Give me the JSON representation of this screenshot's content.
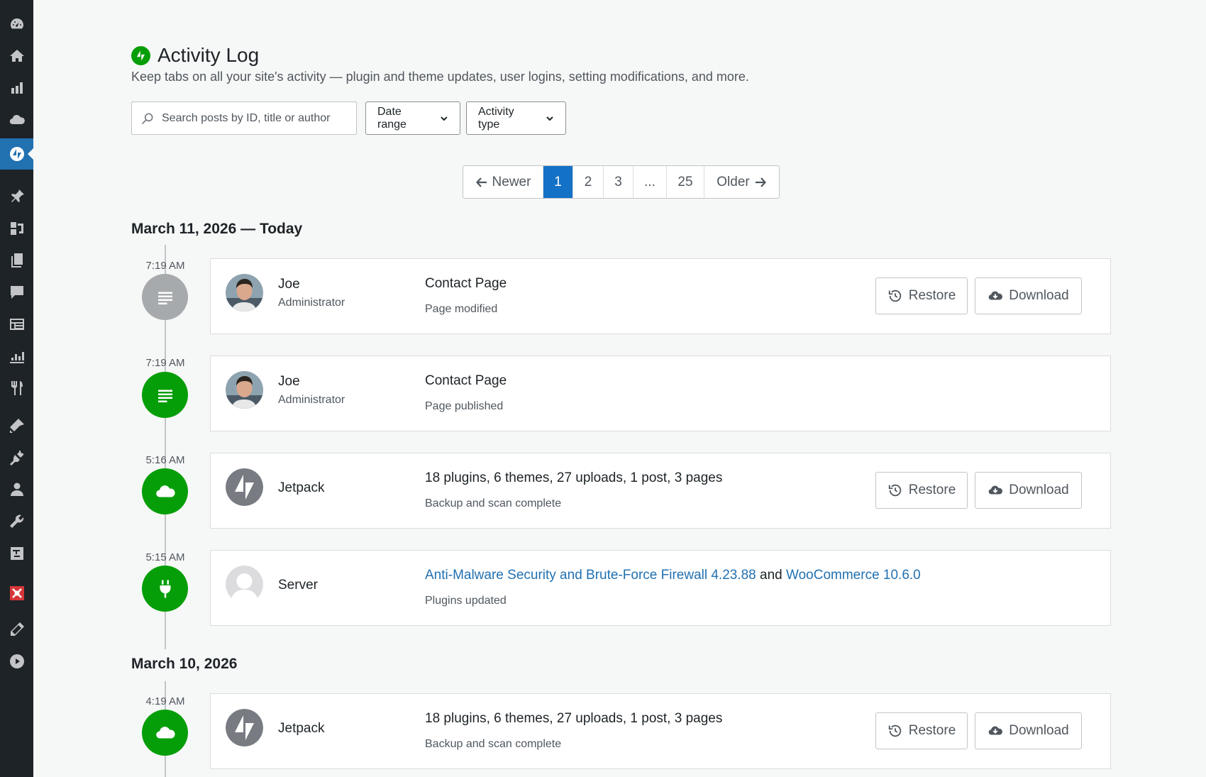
{
  "sidebar": {
    "items": [
      {
        "icon": "dashboard-icon"
      },
      {
        "icon": "home-icon"
      },
      {
        "icon": "stats-icon"
      },
      {
        "icon": "cloud-icon"
      },
      {
        "icon": "jetpack-icon",
        "active": true
      },
      {
        "icon": "pin-icon"
      },
      {
        "icon": "media-icon"
      },
      {
        "icon": "pages-icon"
      },
      {
        "icon": "comments-icon"
      },
      {
        "icon": "feedback-icon"
      },
      {
        "icon": "analytics-icon"
      },
      {
        "icon": "food-icon"
      },
      {
        "icon": "appearance-icon"
      },
      {
        "icon": "plugins-icon"
      },
      {
        "icon": "users-icon"
      },
      {
        "icon": "tools-icon"
      },
      {
        "icon": "settings-icon"
      },
      {
        "icon": "security-plugin-icon"
      },
      {
        "icon": "pencil-icon"
      },
      {
        "icon": "collapse-menu-icon"
      }
    ]
  },
  "header": {
    "title": "Activity Log",
    "subtitle": "Keep tabs on all your site's activity — plugin and theme updates, user logins, setting modifications, and more."
  },
  "filters": {
    "search_placeholder": "Search posts by ID, title or author",
    "date_range_label": "Date range",
    "activity_type_label": "Activity type"
  },
  "pagination": {
    "newer_label": "Newer",
    "older_label": "Older",
    "pages": [
      "1",
      "2",
      "3",
      "...",
      "25"
    ],
    "current": "1"
  },
  "groups": [
    {
      "date": "March 11, 2026 — Today",
      "entries": [
        {
          "time": "7:19 AM",
          "icon": "document-icon",
          "icon_color": "#a7aaad",
          "actor": "Joe",
          "role": "Administrator",
          "title": "Contact Page",
          "description": "Page modified",
          "restore": "Restore",
          "download": "Download"
        },
        {
          "time": "7:19 AM",
          "icon": "document-icon",
          "icon_color": "#069e08",
          "actor": "Joe",
          "role": "Administrator",
          "title": "Contact Page",
          "description": "Page published"
        },
        {
          "time": "5:16 AM",
          "icon": "cloud-icon",
          "icon_color": "#069e08",
          "actor": "Jetpack",
          "title": "18 plugins, 6 themes, 27 uploads, 1 post, 3 pages",
          "description": "Backup and scan complete",
          "restore": "Restore",
          "download": "Download"
        },
        {
          "time": "5:15 AM",
          "icon": "plug-icon",
          "icon_color": "#069e08",
          "actor": "Server",
          "title_link1": "Anti-Malware Security and Brute-Force Firewall 4.23.88",
          "title_and": "and",
          "title_link2": "WooCommerce 10.6.0",
          "description": "Plugins updated"
        }
      ]
    },
    {
      "date": "March 10, 2026",
      "entries": [
        {
          "time": "4:19 AM",
          "icon": "cloud-icon",
          "icon_color": "#069e08",
          "actor": "Jetpack",
          "title": "18 plugins, 6 themes, 27 uploads, 1 post, 3 pages",
          "description": "Backup and scan complete",
          "restore": "Restore",
          "download": "Download"
        }
      ]
    }
  ]
}
